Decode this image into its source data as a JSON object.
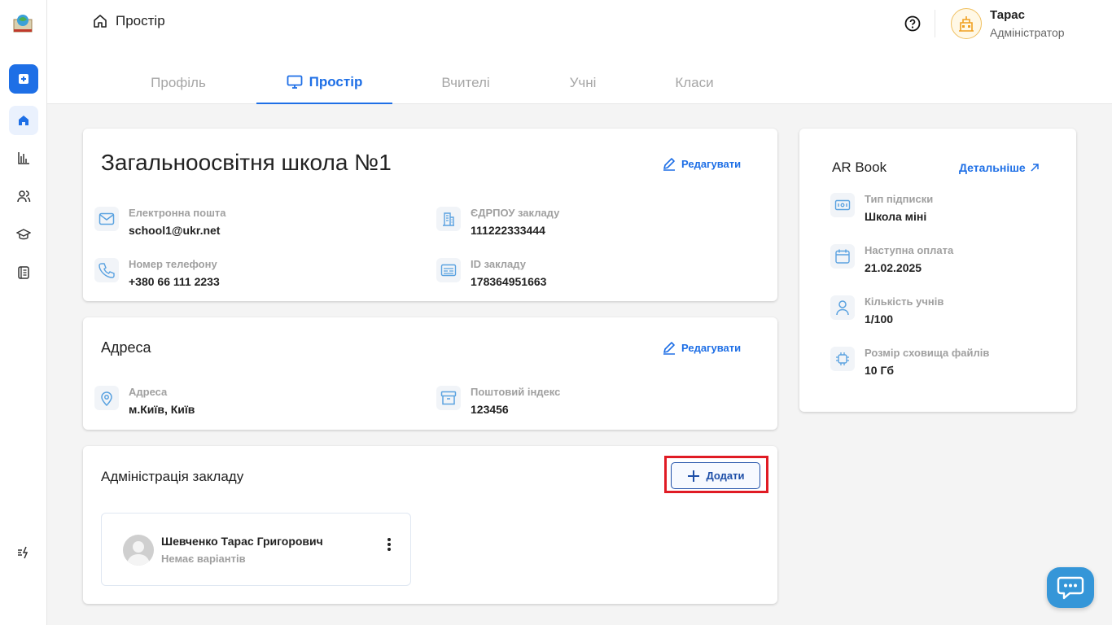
{
  "header": {
    "breadcrumb": "Простір",
    "user": {
      "name": "Тарас",
      "role": "Адміністратор"
    }
  },
  "tabs": [
    {
      "label": "Профіль"
    },
    {
      "label": "Простір"
    },
    {
      "label": "Вчителі"
    },
    {
      "label": "Учні"
    },
    {
      "label": "Класи"
    }
  ],
  "school": {
    "title": "Загальноосвітня школа №1",
    "edit_label": "Редагувати",
    "email": {
      "label": "Електронна пошта",
      "value": "school1@ukr.net"
    },
    "edrpou": {
      "label": "ЄДРПОУ закладу",
      "value": "111222333444"
    },
    "phone": {
      "label": "Номер телефону",
      "value": "+380 66 111 2233"
    },
    "id": {
      "label": "ID закладу",
      "value": "178364951663"
    }
  },
  "address": {
    "title": "Адреса",
    "edit_label": "Редагувати",
    "address": {
      "label": "Адреса",
      "value": "м.Київ, Київ"
    },
    "postal": {
      "label": "Поштовий індекс",
      "value": "123456"
    }
  },
  "admin": {
    "title": "Адміністрація закладу",
    "add_label": "Додати",
    "people": [
      {
        "name": "Шевченко Тарас Григорович",
        "subtitle": "Немає варіантів"
      }
    ]
  },
  "subscription": {
    "title": "AR Book",
    "more_label": "Детальніше",
    "items": [
      {
        "label": "Тип підписки",
        "value": "Школа міні"
      },
      {
        "label": "Наступна оплата",
        "value": "21.02.2025"
      },
      {
        "label": "Кількість учнів",
        "value": "1/100"
      },
      {
        "label": "Розмір сховища файлів",
        "value": "10 Гб"
      }
    ]
  },
  "colors": {
    "accent": "#1e6fe6",
    "highlight": "#e01b24",
    "chat": "#3596d8"
  }
}
